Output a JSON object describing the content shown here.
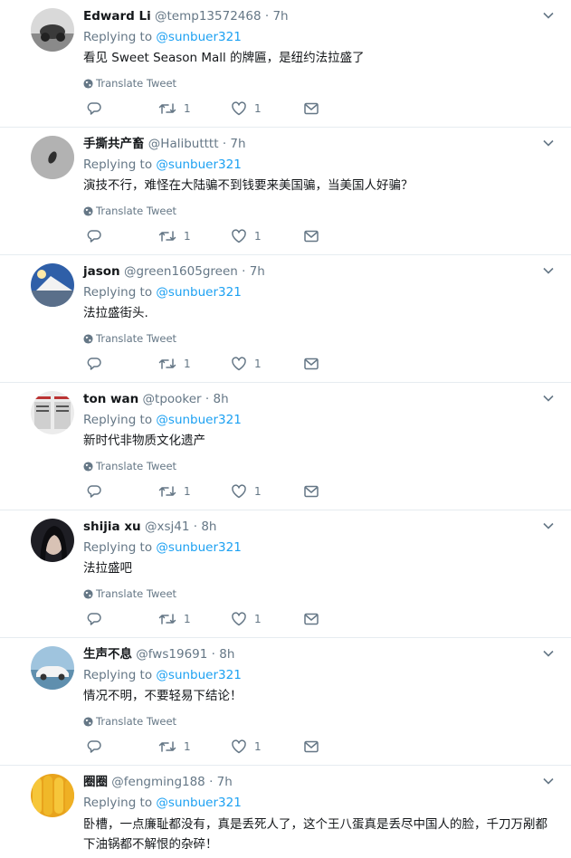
{
  "ui": {
    "replying_to": "Replying to",
    "translate": "Translate Tweet"
  },
  "tweets": [
    {
      "name": "Edward Li",
      "handle": "@temp13572468",
      "time": "7h",
      "mention": "@sunbuer321",
      "text": "看见 Sweet Season Mall 的牌匾，是纽约法拉盛了",
      "retweets": "1",
      "likes": "1",
      "show_translate": true
    },
    {
      "name": "手撕共产畜",
      "handle": "@Halibutttt",
      "time": "7h",
      "mention": "@sunbuer321",
      "text": "演技不行，难怪在大陆骗不到钱要来美国骗，当美国人好骗？",
      "retweets": "1",
      "likes": "1",
      "show_translate": true
    },
    {
      "name": "jason",
      "handle": "@green1605green",
      "time": "7h",
      "mention": "@sunbuer321",
      "text": "法拉盛街头.",
      "retweets": "1",
      "likes": "1",
      "show_translate": true
    },
    {
      "name": "ton wan",
      "handle": "@tpooker",
      "time": "8h",
      "mention": "@sunbuer321",
      "text": "新时代非物质文化遗产",
      "retweets": "1",
      "likes": "1",
      "show_translate": true
    },
    {
      "name": "shijia xu",
      "handle": "@xsj41",
      "time": "8h",
      "mention": "@sunbuer321",
      "text": "法拉盛吧",
      "retweets": "1",
      "likes": "1",
      "show_translate": true
    },
    {
      "name": "生声不息",
      "handle": "@fws19691",
      "time": "8h",
      "mention": "@sunbuer321",
      "text": "情况不明，不要轻易下结论！",
      "retweets": "1",
      "likes": "1",
      "show_translate": true
    },
    {
      "name": "圈圈",
      "handle": "@fengming188",
      "time": "7h",
      "mention": "@sunbuer321",
      "text": "卧槽，一点廉耻都没有，真是丢死人了，这个王八蛋真是丢尽中国人的脸，千刀万剐都下油锅都不解恨的杂碎！",
      "retweets": "",
      "likes": "",
      "show_translate": false
    }
  ]
}
